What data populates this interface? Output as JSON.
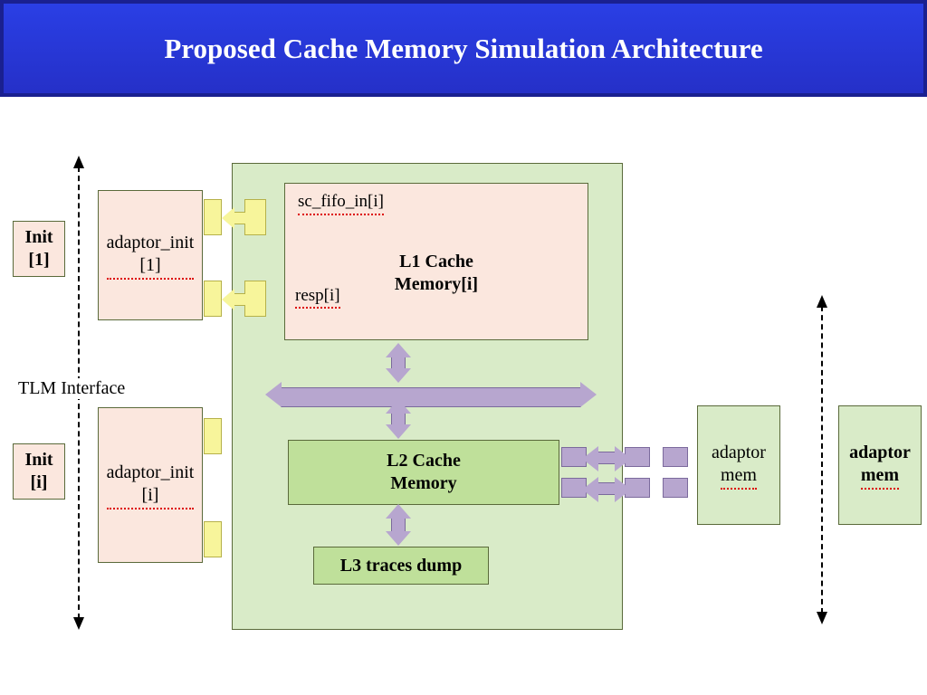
{
  "title": "Proposed Cache Memory Simulation Architecture",
  "init1": "Init\n[1]",
  "initi": "Init\n[i]",
  "adaptor_init1": "adaptor_init\n[1]",
  "adaptor_initi": "adaptor_init\n[i]",
  "tlm": "TLM  Interface",
  "sc_fifo": "sc_fifo_in[i]",
  "resp": "resp[i]",
  "l1": "L1 Cache\nMemory[i]",
  "l2": "L2 Cache\nMemory",
  "l3": "L3 traces dump",
  "adaptor_mem1": "adaptor\nmem",
  "adaptor_mem2": "adaptor\nmem"
}
